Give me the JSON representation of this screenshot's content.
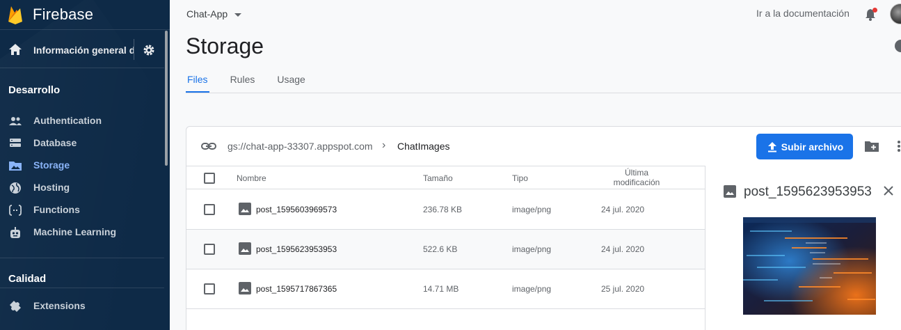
{
  "brand": {
    "name": "Firebase",
    "colors": {
      "sidebar": "#0e2a47",
      "accent": "#1a73e8"
    }
  },
  "sidebar": {
    "overview_label": "Información general del proyecto",
    "sections": [
      {
        "title": "Desarrollo"
      },
      {
        "title": "Calidad"
      }
    ],
    "items": [
      {
        "label": "Authentication",
        "icon": "users-icon"
      },
      {
        "label": "Database",
        "icon": "database-icon"
      },
      {
        "label": "Storage",
        "icon": "folder-image-icon",
        "active": true
      },
      {
        "label": "Hosting",
        "icon": "globe-icon"
      },
      {
        "label": "Functions",
        "icon": "functions-icon"
      },
      {
        "label": "Machine Learning",
        "icon": "robot-icon"
      },
      {
        "label": "Extensions",
        "icon": "puzzle-icon"
      }
    ]
  },
  "header": {
    "project": "Chat-App",
    "docs_link": "Ir a la documentación",
    "title": "Storage",
    "tabs": [
      {
        "label": "Files",
        "active": true
      },
      {
        "label": "Rules"
      },
      {
        "label": "Usage"
      }
    ]
  },
  "storage": {
    "bucket": "gs://chat-app-33307.appspot.com",
    "folder": "ChatImages",
    "upload_label": "Subir archivo",
    "columns": {
      "name": "Nombre",
      "size": "Tamaño",
      "type": "Tipo",
      "modified_line1": "Última",
      "modified_line2": "modificación"
    },
    "files": [
      {
        "name": "post_1595603969573",
        "size": "236.78 KB",
        "type": "image/png",
        "modified": "24 jul. 2020"
      },
      {
        "name": "post_1595623953953",
        "size": "522.6 KB",
        "type": "image/png",
        "modified": "24 jul. 2020"
      },
      {
        "name": "post_1595717867365",
        "size": "14.71 MB",
        "type": "image/png",
        "modified": "25 jul. 2020"
      }
    ],
    "preview": {
      "title": "post_1595623953953"
    }
  }
}
